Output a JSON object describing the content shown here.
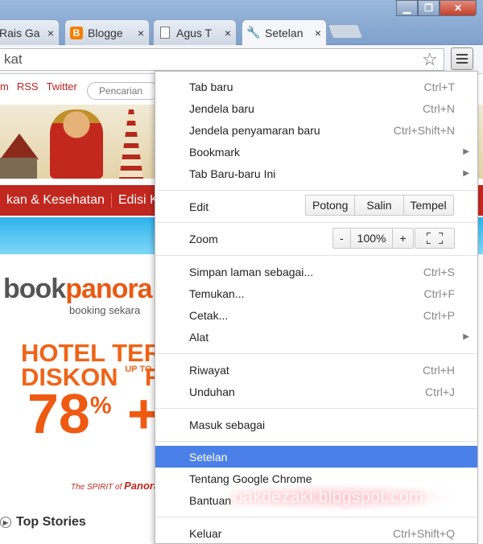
{
  "tabs": [
    {
      "title": "Rais Ga",
      "favicon": "none"
    },
    {
      "title": "Blogge",
      "favicon": "blogger-icon"
    },
    {
      "title": "Agus T",
      "favicon": "page-icon"
    },
    {
      "title": "Setelan",
      "favicon": "wrench-icon"
    }
  ],
  "tab_close_glyph": "×",
  "omnibox": {
    "value": "kat"
  },
  "page": {
    "topnav": [
      "m",
      "RSS",
      "Twitter"
    ],
    "search_placeholder": "Pencarian",
    "nav_items": [
      "kan & Kesehatan",
      "Edisi Khu"
    ],
    "logo_book": "book",
    "logo_pan": "panora",
    "logo_sub": "booking sekara",
    "ad_line1": "HOTEL TER",
    "ad_line2": "DISKON",
    "ad_upto": "UP TO",
    "ad_line2_end": "R",
    "ad_percent": "78",
    "ad_pct_sign": "%",
    "ad_plus": "+",
    "ad_spirit_prefix": "The SPIRIT of",
    "ad_spirit_brand": "Panoran",
    "top_stories": "Top Stories"
  },
  "menu": {
    "items": [
      {
        "label": "Tab baru",
        "shortcut": "Ctrl+T"
      },
      {
        "label": "Jendela baru",
        "shortcut": "Ctrl+N"
      },
      {
        "label": "Jendela penyamaran baru",
        "shortcut": "Ctrl+Shift+N"
      },
      {
        "label": "Bookmark",
        "submenu": true
      },
      {
        "label": "Tab Baru-baru Ini",
        "submenu": true
      }
    ],
    "edit": {
      "label": "Edit",
      "cut": "Potong",
      "copy": "Salin",
      "paste": "Tempel"
    },
    "zoom": {
      "label": "Zoom",
      "minus": "-",
      "value": "100%",
      "plus": "+"
    },
    "items2": [
      {
        "label": "Simpan laman sebagai...",
        "shortcut": "Ctrl+S"
      },
      {
        "label": "Temukan...",
        "shortcut": "Ctrl+F"
      },
      {
        "label": "Cetak...",
        "shortcut": "Ctrl+P"
      },
      {
        "label": "Alat",
        "submenu": true
      }
    ],
    "items3": [
      {
        "label": "Riwayat",
        "shortcut": "Ctrl+H"
      },
      {
        "label": "Unduhan",
        "shortcut": "Ctrl+J"
      }
    ],
    "signin": "Masuk sebagai",
    "items4": [
      {
        "label": "Setelan",
        "highlight": true
      },
      {
        "label": "Tentang Google Chrome"
      },
      {
        "label": "Bantuan"
      }
    ],
    "exit": {
      "label": "Keluar",
      "shortcut": "Ctrl+Shift+Q"
    },
    "submenu_arrow": "▶"
  },
  "watermark": "pakdezaki.blogspot.com",
  "colors": {
    "highlight": "#4a80e8",
    "nav_red": "#c0281f",
    "accent_orange": "#ef6418"
  }
}
